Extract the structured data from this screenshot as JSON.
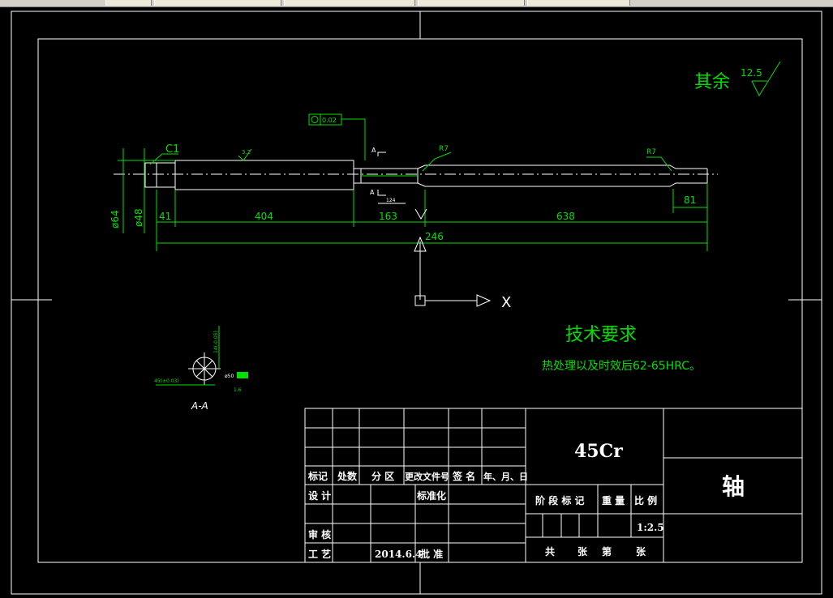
{
  "colors": {
    "background": "#000000",
    "lines": "#ffffff",
    "annotation": "#00e000"
  },
  "drawing": {
    "surface_finish": {
      "text": "其余",
      "value": "12.5"
    },
    "tolerance_frame": "0.02",
    "chamfer": "C1",
    "roughness_small": "3.2",
    "radius_left": "R7",
    "radius_right": "R7",
    "section_marker": "A",
    "groove_note": "124",
    "dims": {
      "d64": "ø64",
      "d48": "ø48",
      "d41": "41",
      "d404": "404",
      "d163": "163",
      "d638": "638",
      "d81": "81",
      "d246": "246"
    },
    "ucs_x": "X",
    "section_label": "A-A",
    "section_dim_left": "45(±0.03)",
    "section_dim_top": "14(-0.05)",
    "section_dim_right": "ø50",
    "section_dim_bottom": "1.6"
  },
  "tech_req": {
    "title": "技术要求",
    "line1": "热处理以及时效后62-65HRC。"
  },
  "title_block": {
    "material": "45Cr",
    "part_name": "轴",
    "hdr_mark": "标记",
    "hdr_count": "处数",
    "hdr_zone": "分 区",
    "hdr_doc": "更改文件号",
    "hdr_sign": "签 名",
    "hdr_date": "年、月、日",
    "design": "设 计",
    "standardize": "标准化",
    "review": "审 核",
    "process": "工 艺",
    "date": "2014.6.4",
    "approve": "批 准",
    "stage": "阶 段 标 记",
    "weight": "重 量",
    "scale_label": "比 例",
    "scale": "1:2.5",
    "sheets_total": "共",
    "sheets": "张",
    "sheet_no": "第",
    "sheet_unit": "张"
  }
}
